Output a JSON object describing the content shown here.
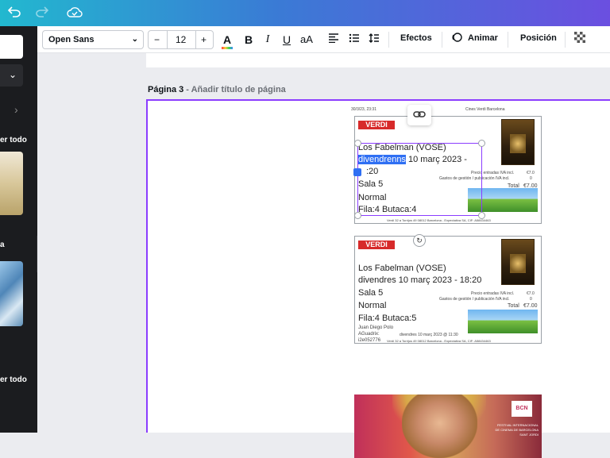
{
  "topbar": {
    "undo_icon": "undo-icon",
    "redo_icon": "redo-icon",
    "cloud_icon": "cloud-check-icon"
  },
  "sidebar": {
    "see_all_1": "er todo",
    "see_all_2": "er todo",
    "letter": "a"
  },
  "toolbar": {
    "font_name": "Open Sans",
    "font_size": "12",
    "minus": "−",
    "plus": "+",
    "text_color": "A",
    "bold": "B",
    "italic": "I",
    "underline": "U",
    "case": "aA",
    "effects": "Efectos",
    "animate": "Animar",
    "position": "Posición"
  },
  "page": {
    "label_bold": "Página 3",
    "label_sub": " - Añadir título de página",
    "header_left": "30/3/23, 23:31",
    "header_right": "Cines Verdi Barcelona"
  },
  "ticket1": {
    "brand": "VERDI",
    "movie": "Los Fabelman (VOSE)",
    "date_hl": "divendrenns",
    "date_rest": " 10 març 2023 -",
    "time": ":20",
    "room": "Sala 5",
    "type": "Normal",
    "seat": "Fila:4 Butaca:4",
    "price_label": "Precio entradas IVA incl.",
    "price_val": "€7.0",
    "fees_label": "Gastos de gestión / publicación IVA incl.",
    "fees_val": "0",
    "total_label": "Total",
    "total_val": "€7.00",
    "footer": "Verdi 32 a Torrijos 49 08012 Barcelona - Expectativa SA, CIF: A58434463"
  },
  "ticket2": {
    "brand": "VERDI",
    "movie": "Los Fabelman (VOSE)",
    "date": "divendres 10 març 2023 - 18:20",
    "room": "Sala 5",
    "type": "Normal",
    "seat": "Fila:4 Butaca:5",
    "price_label": "Precio entradas IVA incl.",
    "price_val": "€7.0",
    "fees_label": "Gastos de gestión / publicación IVA incl.",
    "fees_val": "0",
    "total_label": "Total",
    "total_val": "€7.00",
    "name": "Juan Diego Polo",
    "agua": "AGuadrix:",
    "code": "i2e052776",
    "purchase": "divendres 10 març 2023 @ 11:30",
    "footer": "Verdi 32 a Torrijos 49 08012 Barcelona - Expectativa SA, CIF: A58434463"
  },
  "film": {
    "logo_text": "BCN",
    "line1": "FESTIVAL INTERNACIONAL",
    "line2": "DE CINEMA DE BARCELONA",
    "line3": "SANT JORDI"
  }
}
